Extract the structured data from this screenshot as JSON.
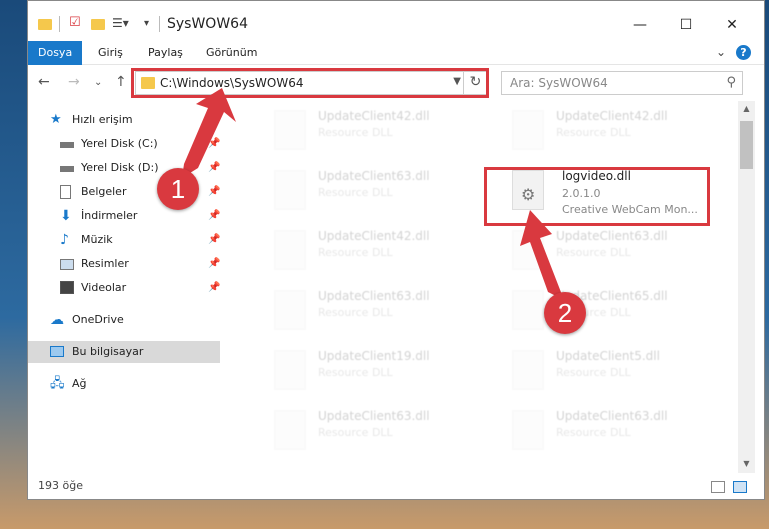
{
  "window": {
    "title": "SysWOW64",
    "minimize": "—",
    "maximize": "☐",
    "close": "✕"
  },
  "ribbon": {
    "tabs": [
      "Dosya",
      "Giriş",
      "Paylaş",
      "Görünüm"
    ],
    "expand": "⌄",
    "help": "?"
  },
  "navigation": {
    "back": "←",
    "forward": "→",
    "recent": "⌄",
    "up": "↑",
    "address": "C:\\Windows\\SysWOW64",
    "refresh": "↻",
    "search_placeholder": "Ara: SysWOW64"
  },
  "nav_pane": {
    "quick_access": "Hızlı erişim",
    "items": [
      {
        "label": "Yerel Disk (C:)",
        "icon": "drive-icon"
      },
      {
        "label": "Yerel Disk (D:)",
        "icon": "drive-icon"
      },
      {
        "label": "Belgeler",
        "icon": "documents-icon"
      },
      {
        "label": "İndirmeler",
        "icon": "downloads-icon"
      },
      {
        "label": "Müzik",
        "icon": "music-icon"
      },
      {
        "label": "Resimler",
        "icon": "pictures-icon"
      },
      {
        "label": "Videolar",
        "icon": "videos-icon"
      }
    ],
    "onedrive": "OneDrive",
    "this_pc": "Bu bilgisayar",
    "network": "Ağ"
  },
  "files": {
    "left_column": [
      {
        "name": "UpdateClient42.dll",
        "sub": "Resource DLL"
      },
      {
        "name": "UpdateClient63.dll",
        "sub": "Resource DLL"
      },
      {
        "name": "UpdateClient42.dll",
        "sub": "Resource DLL"
      },
      {
        "name": "UpdateClient63.dll",
        "sub": "Resource DLL"
      },
      {
        "name": "UpdateClient19.dll",
        "sub": "Resource DLL"
      },
      {
        "name": "UpdateClient63.dll",
        "sub": "Resource DLL"
      }
    ],
    "right_column": [
      {
        "name": "UpdateClient42.dll",
        "sub": "Resource DLL"
      },
      {
        "name": "UpdateClient63.dll",
        "sub": "Resource DLL"
      },
      {
        "name": "UpdateClient65.dll",
        "sub": "Resource DLL"
      },
      {
        "name": "UpdateClient5.dll",
        "sub": "Resource DLL"
      },
      {
        "name": "UpdateClient63.dll",
        "sub": "Resource DLL"
      }
    ],
    "highlighted": {
      "name": "logvideo.dll",
      "version": "2.0.1.0",
      "description": "Creative WebCam Mon..."
    }
  },
  "status": {
    "count": "193 öğe"
  },
  "annotations": {
    "step1": "1",
    "step2": "2",
    "color": "#d9393f"
  }
}
